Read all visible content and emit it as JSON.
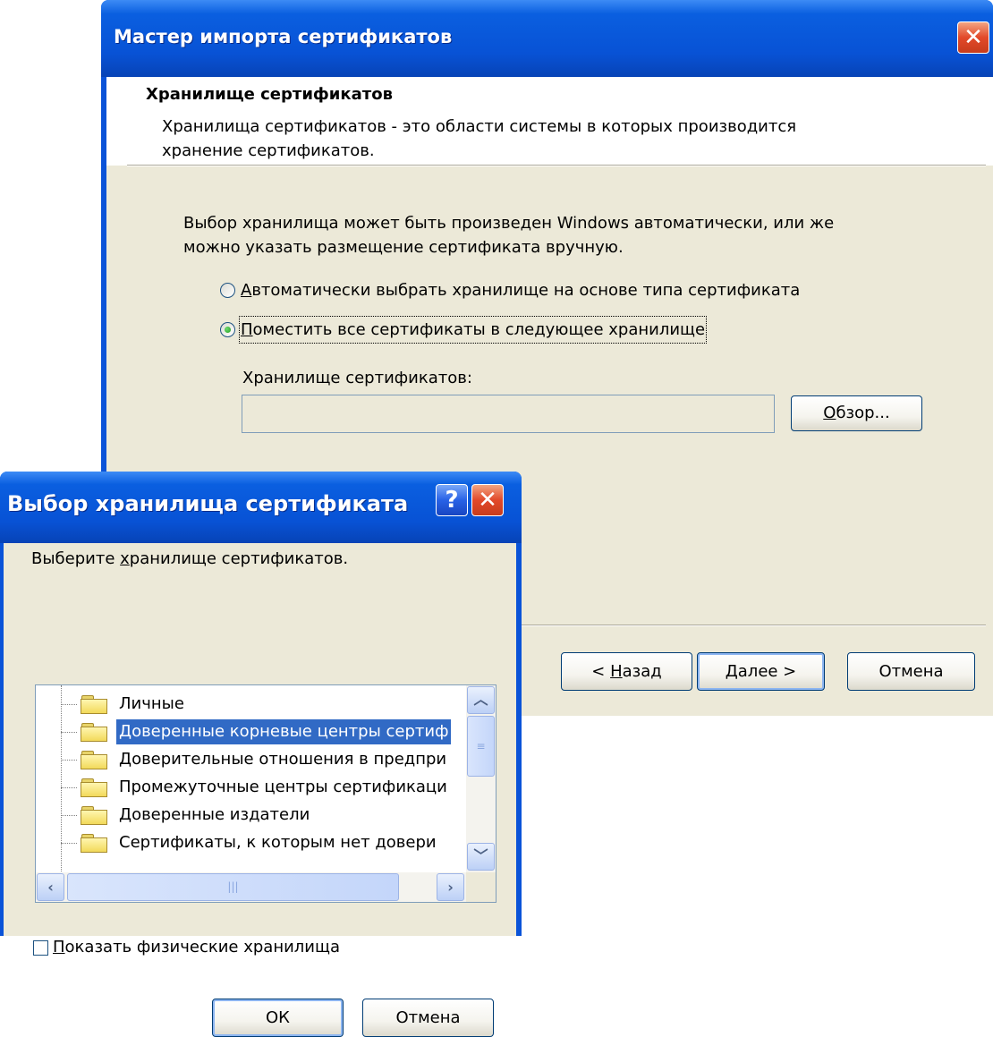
{
  "wizard": {
    "title": "Мастер импорта сертификатов",
    "header_title": "Хранилище сертификатов",
    "header_desc_line1": "Хранилища сертификатов - это области системы в которых производится",
    "header_desc_line2": "хранение сертификатов.",
    "intro_line1": "Выбор хранилища может быть произведен Windows автоматически, или же",
    "intro_line2": "можно указать размещение сертификата вручную.",
    "radio_auto": {
      "accel": "А",
      "rest": "втоматически выбрать хранилище на основе типа сертификата",
      "selected": false
    },
    "radio_manual": {
      "accel": "П",
      "rest": "оместить все сертификаты в следующее хранилище",
      "selected": true
    },
    "store_label": "Хранилище сертификатов:",
    "store_value": "",
    "browse": {
      "accel": "О",
      "rest": "бзор..."
    },
    "back": {
      "prefix": "< ",
      "accel": "Н",
      "rest": "азад"
    },
    "next": {
      "accel": "Д",
      "rest": "алее >"
    },
    "cancel": "Отмена"
  },
  "store_dialog": {
    "title": "Выбор хранилища сертификата",
    "prompt": {
      "prefix": "Выберите ",
      "accel": "х",
      "rest": "ранилище сертификатов."
    },
    "items": [
      "Личные",
      "Доверенные корневые центры сертиф",
      "Доверительные отношения в предпри",
      "Промежуточные центры сертификаци",
      "Доверенные издатели",
      "Сертификаты, к которым нет довери"
    ],
    "selected_index": 1,
    "show_physical": {
      "accel": "П",
      "rest": "оказать физические хранилища",
      "checked": false
    },
    "ok": "ОК",
    "cancel": "Отмена"
  },
  "colors": {
    "titlebar": "#0852d5",
    "dialog_face": "#ece9d8",
    "selection": "#316ac5",
    "close_button": "#e2492a"
  }
}
